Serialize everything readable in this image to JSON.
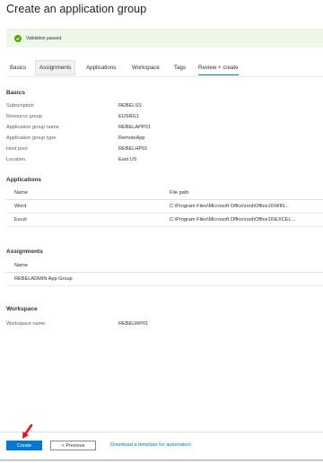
{
  "page": {
    "title": "Create an application group"
  },
  "banner": {
    "message": "Validation passed.",
    "icon": "check-circle-icon",
    "color": "#57a300"
  },
  "tabs": [
    {
      "label": "Basics"
    },
    {
      "label": "Assignments"
    },
    {
      "label": "Applications"
    },
    {
      "label": "Workspace"
    },
    {
      "label": "Tags"
    },
    {
      "label": "Review + create"
    }
  ],
  "basics": {
    "heading": "Basics",
    "rows": [
      {
        "key": "Subscription",
        "value": "REBELSS"
      },
      {
        "key": "Resource group",
        "value": "EUSRG1"
      },
      {
        "key": "Application group name",
        "value": "REBELAPP01"
      },
      {
        "key": "Application group type",
        "value": "RemoteApp"
      },
      {
        "key": "Host pool",
        "value": "REBELHP01"
      },
      {
        "key": "Location",
        "value": "East US"
      }
    ]
  },
  "applications": {
    "heading": "Applications",
    "columns": [
      "Name",
      "File path"
    ],
    "rows": [
      {
        "name": "Word",
        "path": "C:\\Program Files\\Microsoft Office\\root\\Office16\\WIN..."
      },
      {
        "name": "Excel",
        "path": "C:\\Program Files\\Microsoft Office\\root\\Office16\\EXCEL..."
      }
    ]
  },
  "assignments": {
    "heading": "Assignments",
    "columns": [
      "Name"
    ],
    "rows": [
      {
        "name": "REBELADMIN App Group"
      }
    ]
  },
  "workspace": {
    "heading": "Workspace",
    "rows": [
      {
        "key": "Workspace name",
        "value": "REBELWP01"
      }
    ]
  },
  "footer": {
    "create_label": "Create",
    "previous_label": "< Previous",
    "template_link": "Download a template for automation"
  },
  "colors": {
    "accent": "#0078d4",
    "success": "#57a300",
    "annotation": "#e81123"
  }
}
